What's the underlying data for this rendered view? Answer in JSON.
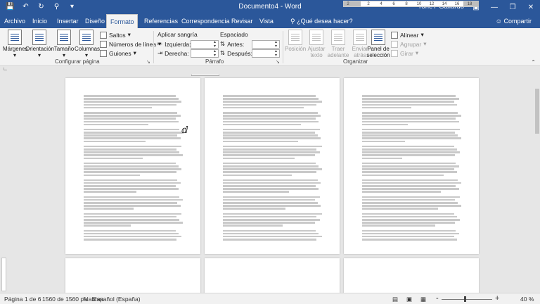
{
  "titlebar": {
    "document_title": "Documento4 - Word",
    "user": "YoneY Gallardo",
    "quick_access": [
      "save-icon",
      "undo-icon",
      "redo-icon",
      "pin-icon",
      "customize-icon"
    ],
    "window_controls": [
      "ribbon-options-icon",
      "minimize-icon",
      "restore-icon",
      "close-icon"
    ]
  },
  "tabs": [
    {
      "label": "Archivo"
    },
    {
      "label": "Inicio"
    },
    {
      "label": "Insertar"
    },
    {
      "label": "Diseño"
    },
    {
      "label": "Formato",
      "active": true
    },
    {
      "label": "Referencias"
    },
    {
      "label": "Correspondencia"
    },
    {
      "label": "Revisar"
    },
    {
      "label": "Vista"
    }
  ],
  "tell_me": "¿Qué desea hacer?",
  "share": "Compartir",
  "ribbon": {
    "configurar": {
      "label": "Configurar página",
      "margenes": "Márgenes",
      "orientacion": "Orientación",
      "tamano": "Tamaño",
      "columnas": "Columnas",
      "saltos": "Saltos",
      "numeros_linea": "Números de línea",
      "guiones": "Guiones"
    },
    "parrafo": {
      "label": "Párrafo",
      "aplicar_sangria": "Aplicar sangría",
      "izquierda": "Izquierda:",
      "derecha": "Derecha:",
      "espaciado": "Espaciado",
      "antes": "Antes:",
      "despues": "Después:"
    },
    "organizar": {
      "label": "Organizar",
      "posicion": "Posición",
      "ajustar_texto": "Ajustar texto",
      "traer_adelante": "Traer adelante",
      "enviar_atras": "Enviar atrás",
      "panel_seleccion": "Panel de selección",
      "alinear": "Alinear",
      "agrupar": "Agrupar",
      "girar": "Girar"
    }
  },
  "ruler": {
    "ticks": [
      "2",
      "2",
      "4",
      "6",
      "8",
      "10",
      "12",
      "14",
      "16",
      "18"
    ]
  },
  "status": {
    "page": "Página 1 de 6",
    "words": "1560 de 1560 palabras",
    "language": "Español (España)",
    "zoom": "40 %",
    "zoom_minus": "-",
    "zoom_plus": "+"
  }
}
